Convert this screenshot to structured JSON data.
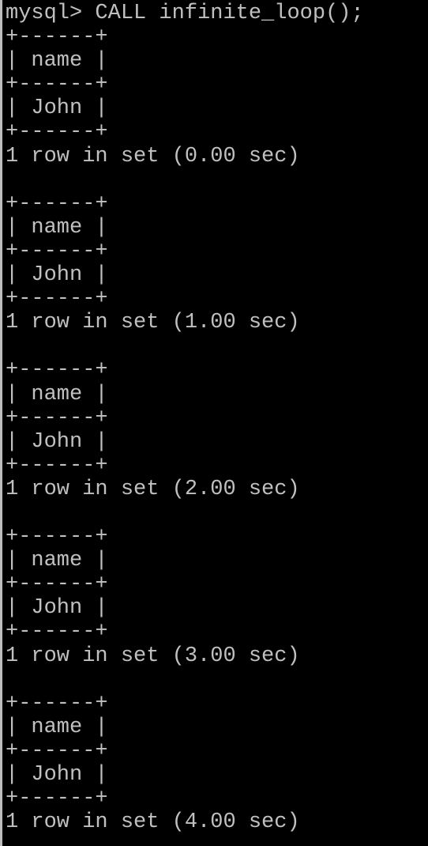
{
  "terminal": {
    "prompt": "mysql> CALL infinite_loop();",
    "border_line": "+------+",
    "header_line": "| name |",
    "row_line": "| John |",
    "results": [
      {
        "footer": "1 row in set (0.00 sec)"
      },
      {
        "footer": "1 row in set (1.00 sec)"
      },
      {
        "footer": "1 row in set (2.00 sec)"
      },
      {
        "footer": "1 row in set (3.00 sec)"
      },
      {
        "footer": "1 row in set (4.00 sec)"
      }
    ]
  },
  "colors": {
    "background": "#000000",
    "text": "#c0c0c0",
    "border": "#bdbdbd"
  }
}
